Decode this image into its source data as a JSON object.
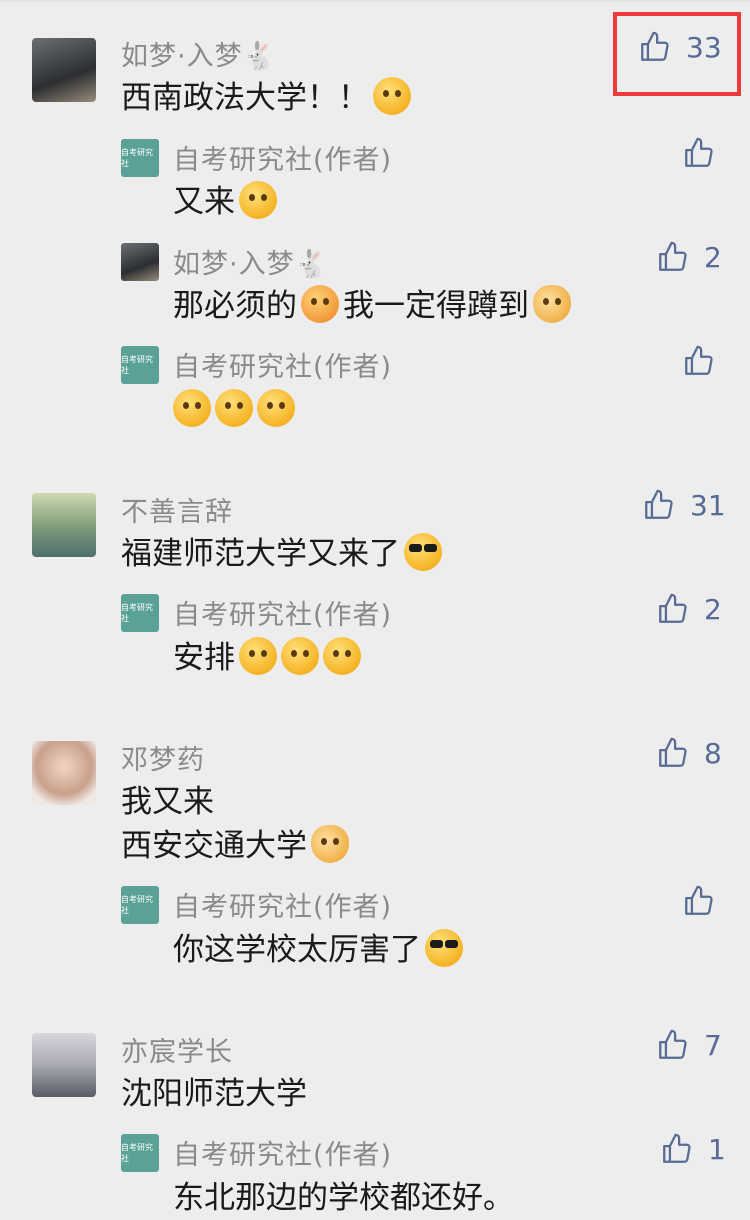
{
  "comments": [
    {
      "name": "如梦·入梦🐇",
      "text": "西南政法大学！！",
      "emoji": "thinking-face-emoji",
      "likes": "33",
      "replies": [
        {
          "name": "自考研究社(作者)",
          "text": "又来",
          "emoji": "tongue-wink-emoji",
          "likes": ""
        },
        {
          "name": "如梦·入梦🐇",
          "text": "那必须的",
          "text2": "我一定得蹲到",
          "likes": "2"
        },
        {
          "name": "自考研究社(作者)",
          "text": "",
          "likes": ""
        }
      ]
    },
    {
      "name": "不善言辞",
      "text": "福建师范大学又来了",
      "likes": "31",
      "replies": [
        {
          "name": "自考研究社(作者)",
          "text": "安排",
          "likes": "2"
        }
      ]
    },
    {
      "name": "邓梦药",
      "text": "我又来",
      "text_line2": "西安交通大学",
      "likes": "8",
      "replies": [
        {
          "name": "自考研究社(作者)",
          "text": "你这学校太厉害了",
          "likes": ""
        }
      ]
    },
    {
      "name": "亦宸学长",
      "text": "沈阳师范大学",
      "likes": "7",
      "replies": [
        {
          "name": "自考研究社(作者)",
          "text": "东北那边的学校都还好。",
          "likes": "1"
        }
      ]
    }
  ],
  "logo_text": "自考研究社",
  "colors": {
    "like": "#576b95",
    "highlight": "#ec3b3b",
    "name": "#8a8a8a",
    "background": "#ededed"
  }
}
